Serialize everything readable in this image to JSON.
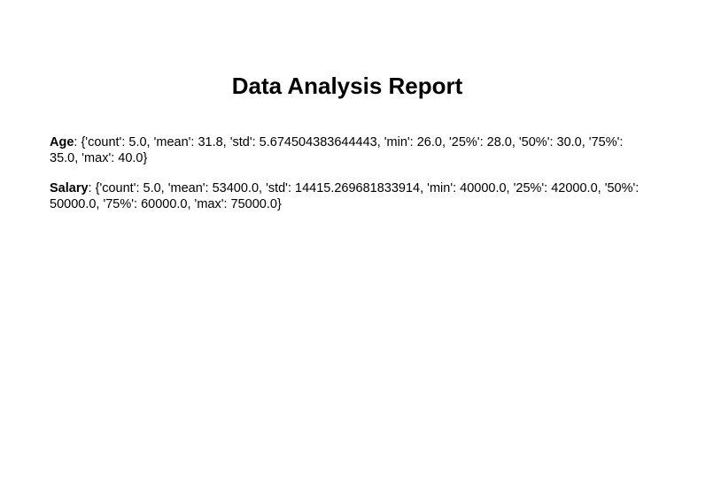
{
  "report": {
    "title": "Data Analysis Report"
  },
  "stats": [
    {
      "label": "Age",
      "separator": ": ",
      "value": "{'count': 5.0, 'mean': 31.8, 'std': 5.674504383644443, 'min': 26.0, '25%': 28.0, '50%': 30.0, '75%': 35.0, 'max': 40.0}"
    },
    {
      "label": "Salary",
      "separator": ": ",
      "value": "{'count': 5.0, 'mean': 53400.0, 'std': 14415.269681833914, 'min': 40000.0, '25%': 42000.0, '50%': 50000.0, '75%': 60000.0, 'max': 75000.0}"
    }
  ]
}
